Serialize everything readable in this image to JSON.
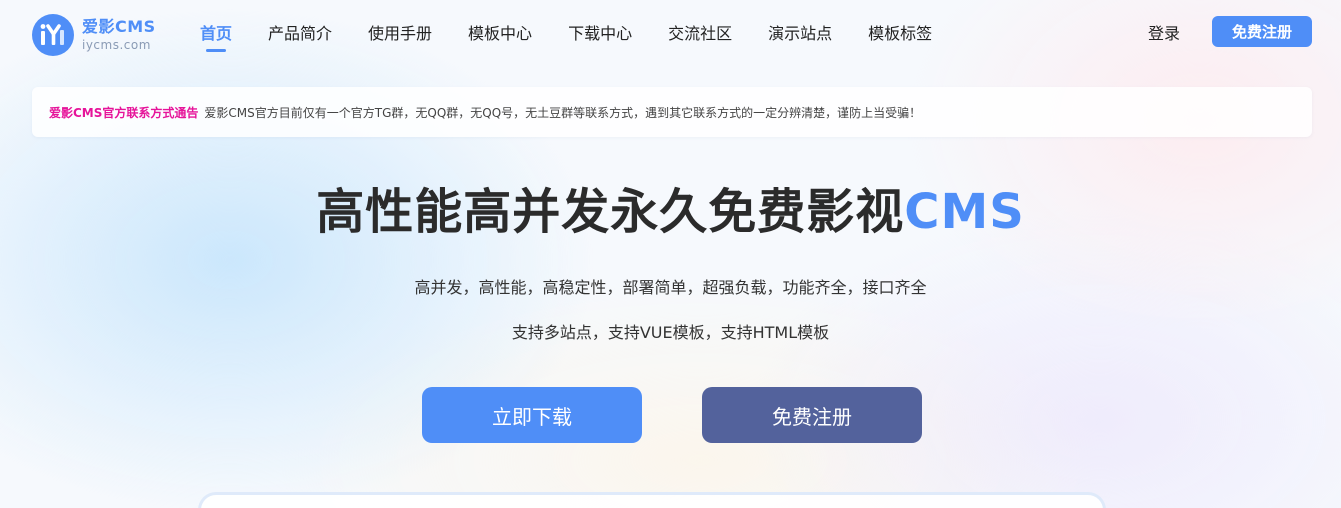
{
  "logo": {
    "title": "爱影CMS",
    "subtitle": "iycms.com",
    "icon": "iy-logo-icon"
  },
  "nav": {
    "items": [
      {
        "label": "首页",
        "active": true
      },
      {
        "label": "产品简介",
        "active": false
      },
      {
        "label": "使用手册",
        "active": false
      },
      {
        "label": "模板中心",
        "active": false
      },
      {
        "label": "下载中心",
        "active": false
      },
      {
        "label": "交流社区",
        "active": false
      },
      {
        "label": "演示站点",
        "active": false
      },
      {
        "label": "模板标签",
        "active": false
      }
    ],
    "login_label": "登录",
    "register_label": "免费注册"
  },
  "notice": {
    "title": "爱影CMS官方联系方式通告",
    "text": "爱影CMS官方目前仅有一个官方TG群，无QQ群，无QQ号，无土豆群等联系方式，遇到其它联系方式的一定分辨清楚，谨防上当受骗！"
  },
  "hero": {
    "title_main": "高性能高并发永久免费影视",
    "title_accent": "CMS",
    "subtitle_line1": "高并发，高性能，高稳定性，部署简单，超强负载，功能齐全，接口齐全",
    "subtitle_line2": "支持多站点，支持VUE模板，支持HTML模板",
    "download_label": "立即下载",
    "register_label": "免费注册"
  },
  "colors": {
    "accent": "#4f8ef7",
    "secondary_button": "#53629c",
    "notice_title": "#e6149a"
  }
}
